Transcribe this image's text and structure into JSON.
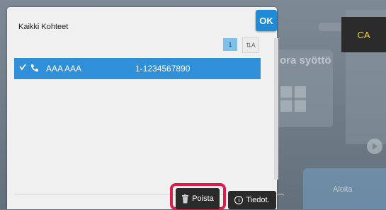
{
  "background": {
    "section_label": "ora syöttö",
    "start_label": "Aloita"
  },
  "ca_button": {
    "label": "CA"
  },
  "dialog": {
    "title": "Kaikki Kohteet",
    "ok_label": "OK",
    "page_number": "1",
    "sort_icon": "sort-az-icon",
    "rows": [
      {
        "name": "AAA AAA",
        "number": "1-1234567890",
        "selected": true,
        "type_icon": "phone-icon"
      }
    ],
    "buttons": {
      "delete_label": "Poista",
      "details_label": "Tiedot."
    }
  },
  "colors": {
    "accent_blue": "#2f8fd8",
    "ca_text": "#f5d327",
    "highlight_red": "#d81e4a"
  }
}
